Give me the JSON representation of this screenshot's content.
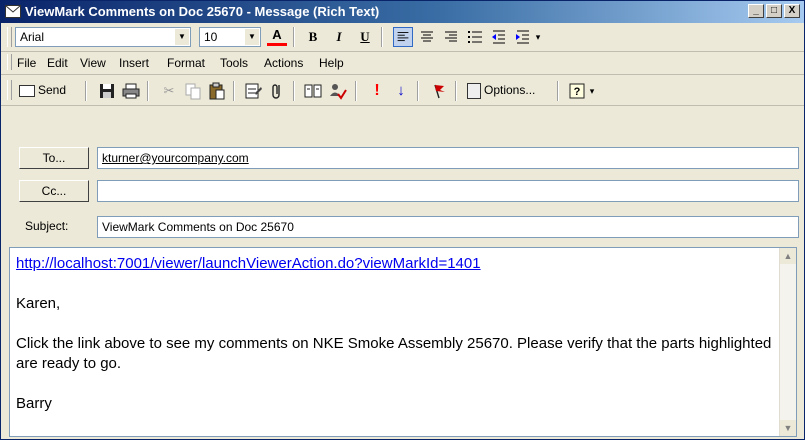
{
  "window": {
    "title": "ViewMark Comments on Doc 25670 - Message (Rich Text)",
    "minimize": "_",
    "maximize": "□",
    "close": "X"
  },
  "format_toolbar": {
    "font": "Arial",
    "size": "10",
    "font_color_glyph": "A",
    "bold": "B",
    "italic": "I",
    "underline": "U"
  },
  "menu": [
    "File",
    "Edit",
    "View",
    "Insert",
    "Format",
    "Tools",
    "Actions",
    "Help"
  ],
  "std_toolbar": {
    "send": "Send",
    "options": "Options...",
    "importance_high": "!",
    "importance_low": "↓"
  },
  "header": {
    "to_button": "To...",
    "cc_button": "Cc...",
    "subject_label": "Subject:",
    "to_value": "kturner@yourcompany.com",
    "cc_value": "",
    "subject_value": "ViewMark Comments on Doc 25670"
  },
  "body": {
    "link": "http://localhost:7001/viewer/launchViewerAction.do?viewMarkId=1401",
    "greeting": "Karen,",
    "message": "Click the link above to see my comments on NKE Smoke Assembly 25670. Please verify that the parts highlighted are ready to go.",
    "signature": "Barry"
  },
  "colors": {
    "title_start": "#0a246a",
    "title_end": "#a6caf0",
    "link": "#0000ee",
    "importance_red": "#ff0000",
    "importance_blue": "#0000cc"
  }
}
